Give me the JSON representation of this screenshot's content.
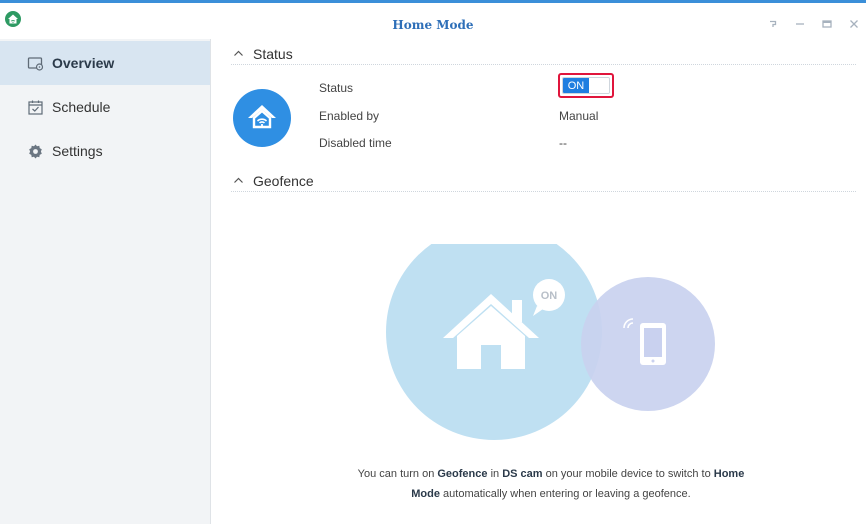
{
  "window": {
    "title": "Home Mode",
    "controls": [
      "help",
      "minimize",
      "maximize",
      "close"
    ]
  },
  "sidebar": {
    "items": [
      {
        "label": "Overview",
        "icon": "overview-icon",
        "active": true
      },
      {
        "label": "Schedule",
        "icon": "calendar-icon",
        "active": false
      },
      {
        "label": "Settings",
        "icon": "gear-icon",
        "active": false
      }
    ]
  },
  "status_section": {
    "header": "Status",
    "rows": [
      {
        "label": "Status",
        "value": "ON"
      },
      {
        "label": "Enabled by",
        "value": "Manual"
      },
      {
        "label": "Disabled time",
        "value": "--"
      }
    ]
  },
  "geofence_section": {
    "header": "Geofence",
    "bubble_label": "ON",
    "info": {
      "p1": "You can turn on ",
      "b1": "Geofence",
      "p2": " in ",
      "b2": "DS cam",
      "p3": " on your mobile device to switch to ",
      "b3": "Home",
      "b4": "Mode",
      "p4": " automatically when entering or leaving a geofence."
    }
  },
  "colors": {
    "accent": "#2f8fe3",
    "toggle_on": "#1f7ee0",
    "highlight_border": "#e0153c",
    "title": "#2e6fb8",
    "sidebar_active": "#d8e5f1",
    "circle_large": "#bfe0f2",
    "circle_small": "#c9d1ef"
  }
}
